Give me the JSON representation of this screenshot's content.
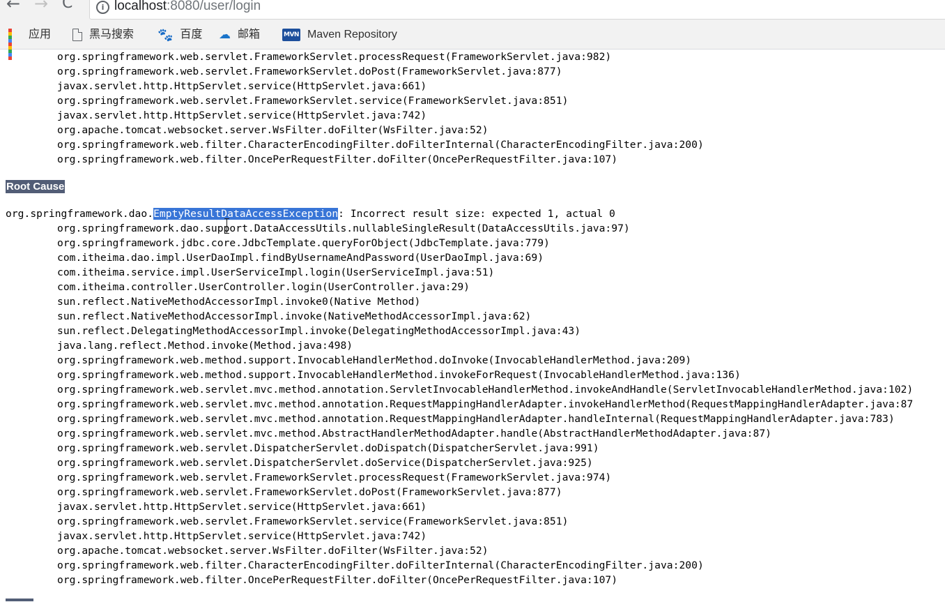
{
  "browser": {
    "nav": {
      "back": "←",
      "forward": "→",
      "reload": "C"
    },
    "address_bar": {
      "host": "localhost",
      "rest": ":8080/user/login"
    },
    "bookmarks": [
      {
        "label": "应用",
        "icon": "apps-grid-icon"
      },
      {
        "label": "黑马搜索",
        "icon": "page-icon"
      },
      {
        "label": "百度",
        "icon": "baidu-paw-icon"
      },
      {
        "label": "邮箱",
        "icon": "mail-cloud-icon"
      },
      {
        "label": "Maven Repository",
        "icon": "mvn-icon",
        "icon_text": "MVN"
      }
    ]
  },
  "page": {
    "top_trace": [
      "org.springframework.web.servlet.FrameworkServlet.processRequest(FrameworkServlet.java:982)",
      "org.springframework.web.servlet.FrameworkServlet.doPost(FrameworkServlet.java:877)",
      "javax.servlet.http.HttpServlet.service(HttpServlet.java:661)",
      "org.springframework.web.servlet.FrameworkServlet.service(FrameworkServlet.java:851)",
      "javax.servlet.http.HttpServlet.service(HttpServlet.java:742)",
      "org.apache.tomcat.websocket.server.WsFilter.doFilter(WsFilter.java:52)",
      "org.springframework.web.filter.CharacterEncodingFilter.doFilterInternal(CharacterEncodingFilter.java:200)",
      "org.springframework.web.filter.OncePerRequestFilter.doFilter(OncePerRequestFilter.java:107)"
    ],
    "root_cause_heading": "Root Cause",
    "exception": {
      "prefix": "org.springframework.dao.",
      "selected": "EmptyResultDataAccessException",
      "suffix": ": Incorrect result size: expected 1, actual 0"
    },
    "root_trace": [
      "org.springframework.dao.support.DataAccessUtils.nullableSingleResult(DataAccessUtils.java:97)",
      "org.springframework.jdbc.core.JdbcTemplate.queryForObject(JdbcTemplate.java:779)",
      "com.itheima.dao.impl.UserDaoImpl.findByUsernameAndPassword(UserDaoImpl.java:69)",
      "com.itheima.service.impl.UserServiceImpl.login(UserServiceImpl.java:51)",
      "com.itheima.controller.UserController.login(UserController.java:29)",
      "sun.reflect.NativeMethodAccessorImpl.invoke0(Native Method)",
      "sun.reflect.NativeMethodAccessorImpl.invoke(NativeMethodAccessorImpl.java:62)",
      "sun.reflect.DelegatingMethodAccessorImpl.invoke(DelegatingMethodAccessorImpl.java:43)",
      "java.lang.reflect.Method.invoke(Method.java:498)",
      "org.springframework.web.method.support.InvocableHandlerMethod.doInvoke(InvocableHandlerMethod.java:209)",
      "org.springframework.web.method.support.InvocableHandlerMethod.invokeForRequest(InvocableHandlerMethod.java:136)",
      "org.springframework.web.servlet.mvc.method.annotation.ServletInvocableHandlerMethod.invokeAndHandle(ServletInvocableHandlerMethod.java:102)",
      "org.springframework.web.servlet.mvc.method.annotation.RequestMappingHandlerAdapter.invokeHandlerMethod(RequestMappingHandlerAdapter.java:87",
      "org.springframework.web.servlet.mvc.method.annotation.RequestMappingHandlerAdapter.handleInternal(RequestMappingHandlerAdapter.java:783)",
      "org.springframework.web.servlet.mvc.method.AbstractHandlerMethodAdapter.handle(AbstractHandlerMethodAdapter.java:87)",
      "org.springframework.web.servlet.DispatcherServlet.doDispatch(DispatcherServlet.java:991)",
      "org.springframework.web.servlet.DispatcherServlet.doService(DispatcherServlet.java:925)",
      "org.springframework.web.servlet.FrameworkServlet.processRequest(FrameworkServlet.java:974)",
      "org.springframework.web.servlet.FrameworkServlet.doPost(FrameworkServlet.java:877)",
      "javax.servlet.http.HttpServlet.service(HttpServlet.java:661)",
      "org.springframework.web.servlet.FrameworkServlet.service(FrameworkServlet.java:851)",
      "javax.servlet.http.HttpServlet.service(HttpServlet.java:742)",
      "org.apache.tomcat.websocket.server.WsFilter.doFilter(WsFilter.java:52)",
      "org.springframework.web.filter.CharacterEncodingFilter.doFilterInternal(CharacterEncodingFilter.java:200)",
      "org.springframework.web.filter.OncePerRequestFilter.doFilter(OncePerRequestFilter.java:107)"
    ]
  },
  "colors": {
    "heading_bg": "#525d76",
    "selection_bg": "#3875d7",
    "apps_grid": [
      "#ea4335",
      "#fbbc04",
      "#34a853",
      "#4285f4",
      "#ea4335",
      "#fbbc04",
      "#34a853",
      "#4285f4",
      "#ea4335"
    ]
  }
}
